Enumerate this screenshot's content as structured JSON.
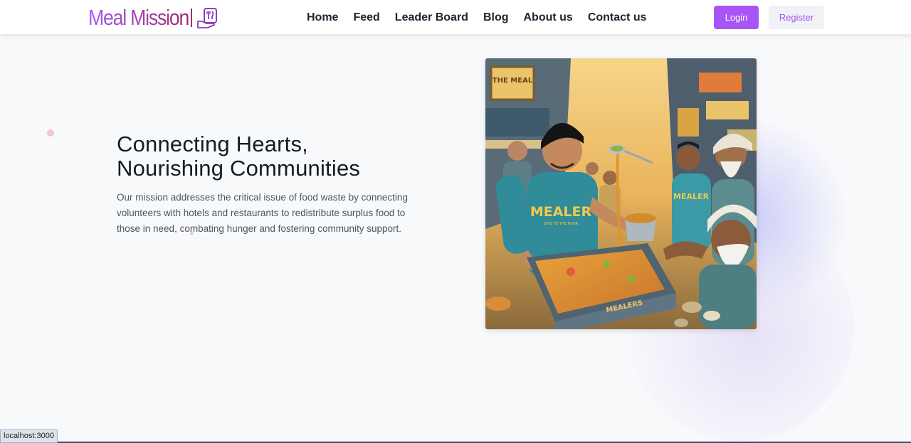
{
  "brand": {
    "name": "Meal Mission",
    "icon": "hand-holding-utensils-icon",
    "color_start": "#a855f7",
    "color_end": "#9b2e6e"
  },
  "nav": {
    "links": [
      "Home",
      "Feed",
      "Leader Board",
      "Blog",
      "About us",
      "Contact us"
    ],
    "login_label": "Login",
    "register_label": "Register"
  },
  "hero": {
    "title_line1": "Connecting Hearts,",
    "title_line2": "Nourishing Communities",
    "description": "Our mission addresses the critical issue of food waste by connecting volunteers with hotels and restaurants to redistribute surplus food to those in need, combating hunger and fostering community support.",
    "image": {
      "tshirt_text": "MEALER",
      "tshirt_subtext": "GIVE TO THE POOR",
      "tray_text": "MEALERS",
      "sign_text": "THE MEAL"
    }
  },
  "status_bar": {
    "url": "localhost:3000"
  },
  "colors": {
    "accent": "#a855f7",
    "background": "#f8f9fb",
    "text": "#1f2430"
  }
}
